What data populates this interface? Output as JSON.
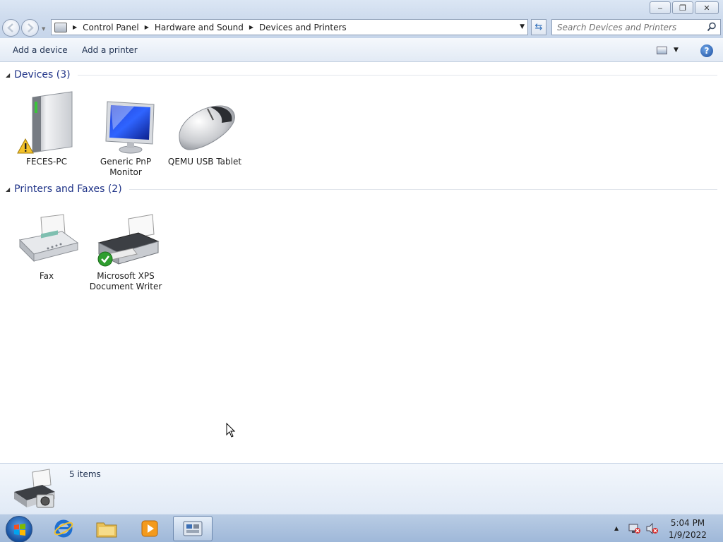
{
  "window": {
    "minimize": "‒",
    "maximize": "❐",
    "close": "✕"
  },
  "address": {
    "breadcrumbs": [
      "Control Panel",
      "Hardware and Sound",
      "Devices and Printers"
    ],
    "search_placeholder": "Search Devices and Printers"
  },
  "toolbar": {
    "add_device": "Add a device",
    "add_printer": "Add a printer",
    "help": "?"
  },
  "groups": {
    "devices": {
      "title": "Devices (3)",
      "items": [
        {
          "label": "FECES-PC",
          "icon": "computer-tower-icon",
          "badge": "warning-icon"
        },
        {
          "label": "Generic PnP Monitor",
          "icon": "monitor-icon"
        },
        {
          "label": "QEMU USB Tablet",
          "icon": "mouse-icon"
        }
      ]
    },
    "printers": {
      "title": "Printers and Faxes (2)",
      "items": [
        {
          "label": "Fax",
          "icon": "fax-icon"
        },
        {
          "label": "Microsoft XPS Document Writer",
          "icon": "printer-icon",
          "badge": "default-check-icon"
        }
      ]
    }
  },
  "details": {
    "count": "5 items"
  },
  "taskbar": {
    "time": "5:04 PM",
    "date": "1/9/2022",
    "pinned": [
      "internet-explorer-icon",
      "windows-explorer-icon",
      "media-player-icon",
      "devices-and-printers-icon"
    ]
  },
  "colors": {
    "group_title": "#1e3287",
    "chrome": "#cfdcee",
    "taskbar": "#a9c0de"
  }
}
